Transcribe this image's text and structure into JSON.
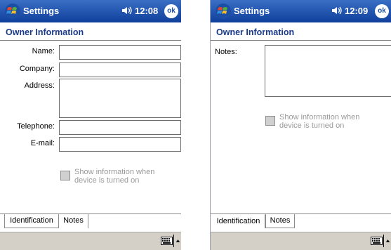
{
  "left": {
    "app_title": "Settings",
    "time": "12:08",
    "ok_label": "ok",
    "section_title": "Owner Information",
    "fields": {
      "name_label": "Name:",
      "company_label": "Company:",
      "address_label": "Address:",
      "telephone_label": "Telephone:",
      "email_label": "E-mail:",
      "name_value": "",
      "company_value": "",
      "address_value": "",
      "telephone_value": "",
      "email_value": ""
    },
    "show_info_line1": "Show information when",
    "show_info_line2": "device is turned on",
    "tabs": [
      "Identification",
      "Notes"
    ],
    "active_tab": "Identification"
  },
  "right": {
    "app_title": "Settings",
    "time": "12:09",
    "ok_label": "ok",
    "section_title": "Owner Information",
    "notes_label": "Notes:",
    "notes_value": "",
    "show_info_line1": "Show information when",
    "show_info_line2": "device is turned on",
    "tabs": [
      "Identification",
      "Notes"
    ],
    "active_tab": "Notes"
  },
  "icons": {
    "start": "windows-flag-icon",
    "volume": "speaker-icon",
    "input": "keyboard-icon",
    "input_arrow": "up-arrow-icon"
  },
  "colors": {
    "titlebar": "#1c4ea6",
    "section_title": "#1a3a8a",
    "menubar": "#d4d0c8"
  }
}
